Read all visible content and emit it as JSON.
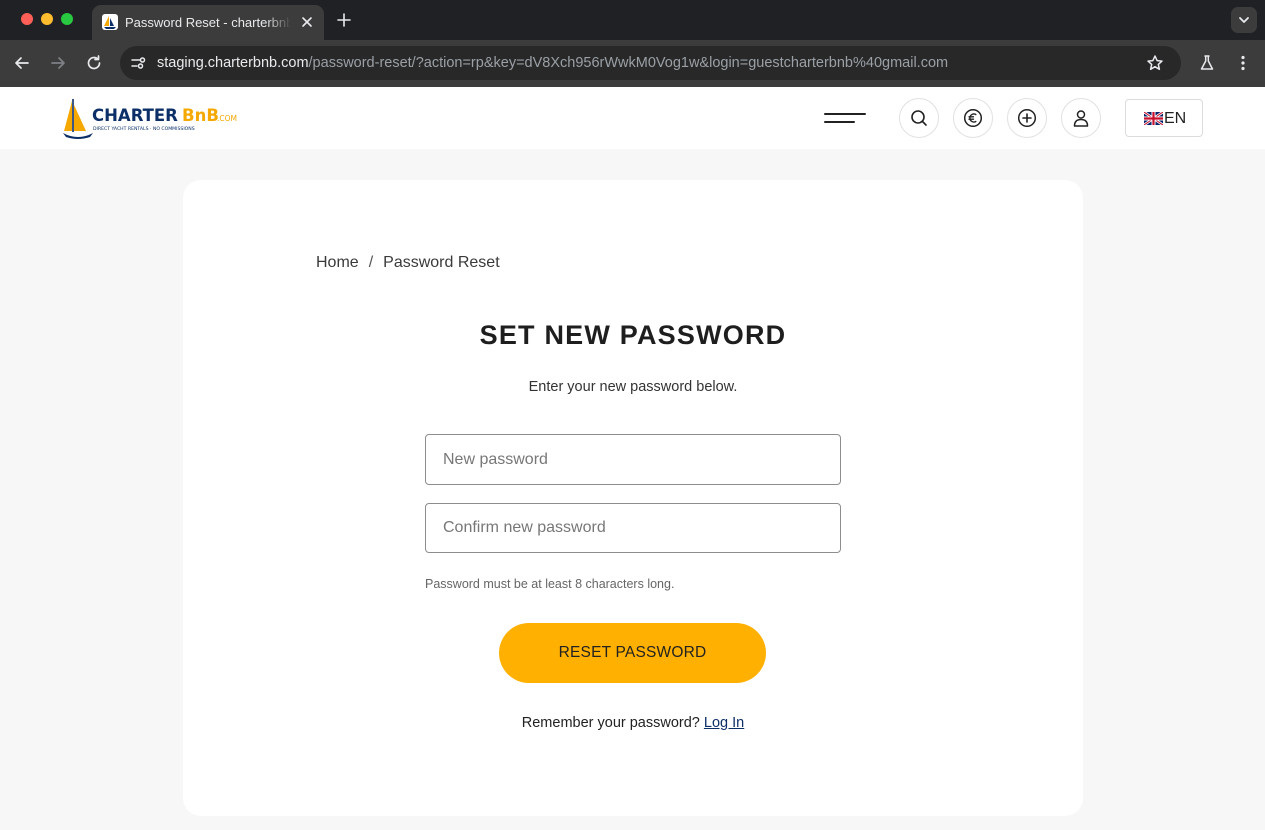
{
  "browser": {
    "tab_title": "Password Reset - charterbnb",
    "url_host": "staging.charterbnb.com",
    "url_path": "/password-reset/?action=rp&key=dV8Xch956rWwkM0Vog1w&login=guestcharterbnb%40gmail.com",
    "icons": [
      "close-icon",
      "plus-icon",
      "chevron-down-icon",
      "back-arrow-icon",
      "forward-arrow-icon",
      "reload-icon",
      "site-info-icon",
      "star-icon",
      "flask-icon",
      "more-vertical-icon"
    ]
  },
  "header": {
    "logo_name": "CHARTER",
    "logo_accent": "BnB",
    "logo_suffix": ".COM",
    "logo_tagline": "DIRECT YACHT RENTALS · NO COMMISSIONS",
    "language": "EN",
    "icons": [
      "menu-icon",
      "search-icon",
      "euro-icon",
      "add-icon",
      "user-icon",
      "uk-flag-icon"
    ]
  },
  "main": {
    "breadcrumb": [
      {
        "label": "Home"
      },
      {
        "label": "Password Reset"
      }
    ],
    "breadcrumb_separator": "/",
    "title": "SET NEW PASSWORD",
    "subtitle": "Enter your new password below.",
    "new_password": {
      "value": "",
      "placeholder": "New password"
    },
    "confirm_password": {
      "value": "",
      "placeholder": "Confirm new password"
    },
    "hint": "Password must be at least 8 characters long.",
    "submit_label": "RESET PASSWORD",
    "remember_text": "Remember your password?",
    "login_link": "Log In"
  },
  "colors": {
    "accent": "#ffb000",
    "brand_navy": "#0d2f68",
    "chrome_dark": "#202124",
    "page_bg": "#f7f7f7"
  }
}
